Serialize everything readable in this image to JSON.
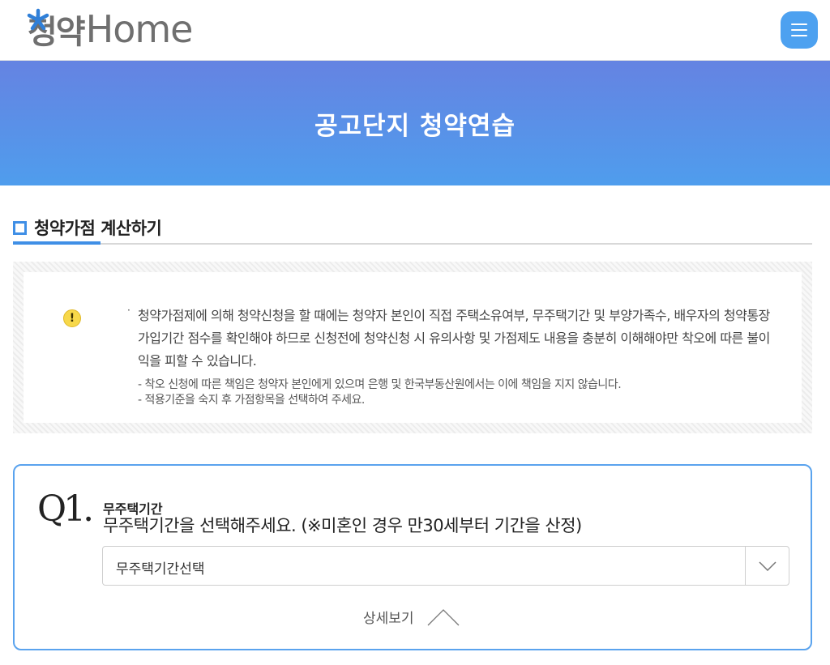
{
  "header": {
    "logo_hangul": "청약",
    "logo_latin": "Home",
    "menu_icon": "hamburger-icon"
  },
  "banner": {
    "title": "공고단지 청약연습"
  },
  "section": {
    "title": "청약가점 계산하기"
  },
  "notice": {
    "icon": "warning-icon",
    "bullet": "·",
    "main_text": "청약가점제에 의해 청약신청을 할 때에는 청약자 본인이 직접 주택소유여부, 무주택기간 및 부양가족수, 배우자의 청약통장가입기간 점수를 확인해야 하므로 신청전에 청약신청 시 유의사항 및 가점제도 내용을 충분히 이해해야만 착오에 따른 불이익을 피할 수 있습니다.",
    "sub_lines": [
      "- 착오 신청에 따른 책임은 청약자 본인에게 있으며 은행 및 한국부동산원에서는 이에 책임을 지지 않습니다.",
      "- 적용기준을 숙지 후 가점항목을 선택하여 주세요."
    ]
  },
  "question": {
    "number": "Q1.",
    "label": "무주택기간",
    "text": "무주택기간을 선택해주세요. (※미혼인 경우 만30세부터 기간을 산정)",
    "select_value": "무주택기간선택",
    "detail_label": "상세보기"
  },
  "colors": {
    "accent": "#4da1f0",
    "banner_top": "#6583e2",
    "banner_bottom": "#4f9ded",
    "logo_star": "#2f7fd8"
  }
}
